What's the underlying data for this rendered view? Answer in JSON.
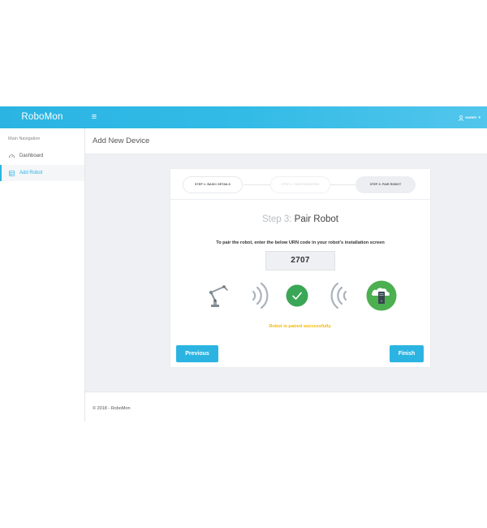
{
  "header": {
    "brand": "RoboMon",
    "menu_icon": "hamburger-icon",
    "user_icon": "user-icon",
    "user_label": "HARRY",
    "caret": "▾"
  },
  "sidebar": {
    "nav_header": "Main Navigation",
    "items": [
      {
        "label": "Dashboard",
        "icon": "dashboard-gauge-icon",
        "active": false
      },
      {
        "label": "Add Robot",
        "icon": "table-grid-icon",
        "active": true
      }
    ]
  },
  "page": {
    "title": "Add New Device"
  },
  "wizard": {
    "steps": [
      {
        "label": "STEP 1: BASIC DETAILS",
        "state": "done"
      },
      {
        "label": "STEP 2: CONFIGURATION",
        "state": "pending"
      },
      {
        "label": "STEP 3: PAIR ROBOT",
        "state": "current"
      }
    ],
    "heading_number": "Step 3:",
    "heading_text": "Pair Robot",
    "instruction": "To pair the robot, enter the below URN code in your robot's installation screen",
    "code": "2707",
    "illustration": [
      "robot-arm-icon",
      "signal-waves-icon",
      "success-check-icon",
      "signal-waves-icon",
      "cloud-server-icon"
    ],
    "status_text": "Robot is paired successfully.",
    "previous_label": "Previous",
    "finish_label": "Finish"
  },
  "footer": {
    "text": "© 2018 - RoboMon"
  },
  "colors": {
    "accent": "#2bb4e2",
    "success": "#3aa757",
    "status_warning": "#f5b800",
    "cloud_green": "#4caf50",
    "content_bg": "#eef0f4"
  }
}
